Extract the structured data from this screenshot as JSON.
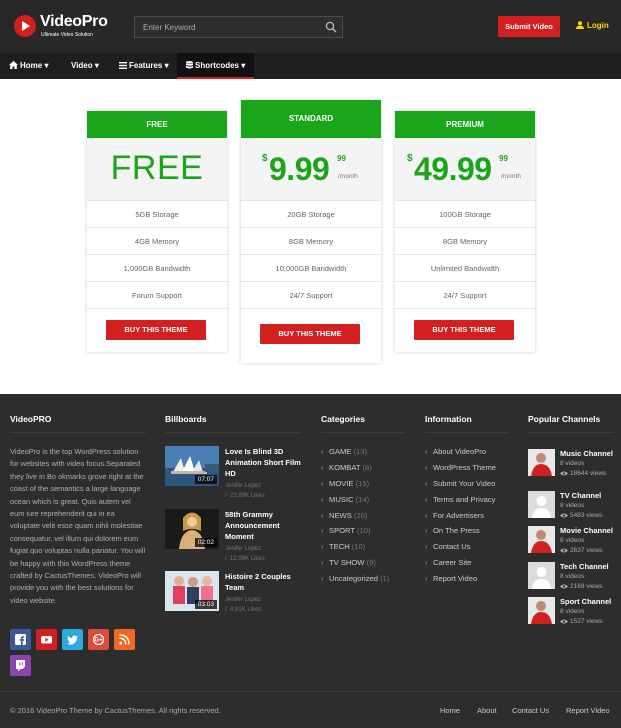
{
  "header": {
    "logo_text": "VideoPro",
    "logo_tagline": "Ultimate Video Solution",
    "search_placeholder": "Enter Keyword",
    "submit_label": "Submit Video",
    "login_label": "Login"
  },
  "nav": [
    {
      "label": "Home",
      "icon": "home-icon"
    },
    {
      "label": "Video"
    },
    {
      "label": "Features",
      "icon": "list-icon"
    },
    {
      "label": "Shortcodes",
      "icon": "database-icon",
      "active": true
    }
  ],
  "plans": [
    {
      "name": "FREE",
      "price_text": "FREE",
      "features": [
        "5GB Storage",
        "4GB Memory",
        "1,000GB Bandwidth",
        "Forum Support"
      ],
      "button": "BUY THIS THEME"
    },
    {
      "name": "STANDARD",
      "currency": "$",
      "price": "9.99",
      "cents": "99",
      "period": "/month",
      "features": [
        "20GB Storage",
        "8GB Memory",
        "10,000GB Bandwidth",
        "24/7 Support"
      ],
      "button": "BUY THIS THEME"
    },
    {
      "name": "PREMIUM",
      "currency": "$",
      "price": "49.99",
      "cents": "99",
      "period": "/month",
      "features": [
        "100GB Storage",
        "8GB Memory",
        "Unlimited Bandwidth",
        "24/7 Support"
      ],
      "button": "BUY THIS THEME"
    }
  ],
  "footer": {
    "about": {
      "title": "VideoPRO",
      "text": "VideoPro is the top WordPress solution for websites with video focus.Separated they live in Bo okmarks grove right at the coast of the semantics a large language ocean which is great. Quis autem vel eum iure reprehenderit qui in ea voluptate velit esse quam nihil molestiae consequatur, vel illum qui dolorem eum fugiat quo voluptas nulla pariatur. You will be happy with this WordPress theme crafted by CactusThemes. VideoPro will provide you with the best solutions for video website."
    },
    "billboards": {
      "title": "Billboards",
      "items": [
        {
          "title": "Love Is Blind 3D Animation Short Film HD",
          "duration": "07:07",
          "author": "Jenifer Lopez",
          "likes": "23.89K Likes"
        },
        {
          "title": "58th Grammy Announcement Moment",
          "duration": "02:02",
          "author": "Jenifer Lopez",
          "likes": "12.09K Likes"
        },
        {
          "title": "Histoire 2 Couples Team",
          "duration": "03:03",
          "author": "Jenifer Lopez",
          "likes": "4.81K Likes"
        }
      ]
    },
    "categories": {
      "title": "Categories",
      "items": [
        {
          "name": "GAME",
          "count": "(13)"
        },
        {
          "name": "KOMBAT",
          "count": "(8)"
        },
        {
          "name": "MOVIE",
          "count": "(15)"
        },
        {
          "name": "MUSIC",
          "count": "(14)"
        },
        {
          "name": "NEWS",
          "count": "(20)"
        },
        {
          "name": "SPORT",
          "count": "(10)"
        },
        {
          "name": "TECH",
          "count": "(10)"
        },
        {
          "name": "TV SHOW",
          "count": "(9)"
        },
        {
          "name": "Uncategorized",
          "count": "(1)"
        }
      ]
    },
    "information": {
      "title": "Information",
      "items": [
        "About VideoPro",
        "WordPress Theme",
        "Submit Your Video",
        "Terms and Privacy",
        "For Advertisers",
        "On The Press",
        "Contact Us",
        "Career Site",
        "Report Video"
      ]
    },
    "channels": {
      "title": "Popular Channels",
      "items": [
        {
          "name": "Music Channel",
          "videos": "8 videos",
          "views": "18644 views",
          "photo": true
        },
        {
          "name": "TV Channel",
          "videos": "8 videos",
          "views": "5483 views",
          "photo": false
        },
        {
          "name": "Movie Channel",
          "videos": "8 videos",
          "views": "2637 views",
          "photo": true
        },
        {
          "name": "Tech Channel",
          "videos": "8 videos",
          "views": "2169 views",
          "photo": false
        },
        {
          "name": "Sport Channel",
          "videos": "8 videos",
          "views": "1527 views",
          "photo": true
        }
      ]
    },
    "social_icons": [
      {
        "name": "facebook-icon",
        "color": "#3b5998"
      },
      {
        "name": "youtube-icon",
        "color": "#d31f1f"
      },
      {
        "name": "twitter-icon",
        "color": "#2fa8e0"
      },
      {
        "name": "google-plus-icon",
        "color": "#dd4b39"
      },
      {
        "name": "rss-icon",
        "color": "#f26522"
      },
      {
        "name": "twitch-icon",
        "color": "#8e44ad"
      }
    ]
  },
  "bottom": {
    "copyright": "© 2016 VideoPro Theme by CactusThemes. All rights reserved.",
    "links": [
      "Home",
      "About",
      "Contact Us",
      "Report Video"
    ]
  },
  "colors": {
    "accent_red": "#d31f1f",
    "plan_green": "#1aa51a",
    "login_yellow": "#ffd700"
  }
}
